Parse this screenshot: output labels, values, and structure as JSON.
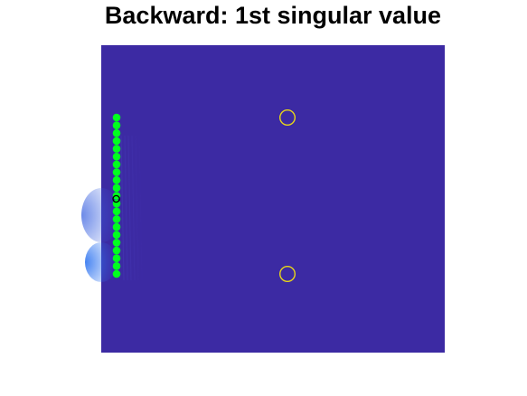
{
  "chart_data": {
    "type": "scatter",
    "title": "Backward: 1st singular value",
    "xlabel": "",
    "ylabel": "",
    "axes_visible": false,
    "background_field": {
      "kind": "intensity-map",
      "base_color": "#3c2aa3",
      "hotspot_color": "#2f74f0",
      "hotspot_location": "left edge, near array"
    },
    "series": [
      {
        "marker": "filled-circle",
        "color": "#00ff1f",
        "points": [
          {
            "x": 1,
            "y": 1
          },
          {
            "x": 1,
            "y": 2
          },
          {
            "x": 1,
            "y": 3
          },
          {
            "x": 1,
            "y": 4
          },
          {
            "x": 1,
            "y": 5
          },
          {
            "x": 1,
            "y": 6
          },
          {
            "x": 1,
            "y": 7
          },
          {
            "x": 1,
            "y": 8
          },
          {
            "x": 1,
            "y": 9
          },
          {
            "x": 1,
            "y": 10
          },
          {
            "x": 1,
            "y": 11
          },
          {
            "x": 1,
            "y": 12
          },
          {
            "x": 1,
            "y": 13
          },
          {
            "x": 1,
            "y": 14
          },
          {
            "x": 1,
            "y": 15
          },
          {
            "x": 1,
            "y": 16
          },
          {
            "x": 1,
            "y": 17
          },
          {
            "x": 1,
            "y": 18
          },
          {
            "x": 1,
            "y": 19
          },
          {
            "x": 1,
            "y": 20
          },
          {
            "x": 1,
            "y": 21
          }
        ]
      },
      {
        "marker": "open-circle",
        "color": "#e8d619",
        "points": [
          {
            "x": 24,
            "y": 1
          },
          {
            "x": 24,
            "y": 21
          }
        ]
      },
      {
        "marker": "small-open-circle",
        "color": "#000000",
        "points": [
          {
            "x": 0.95,
            "y": 11.4
          }
        ]
      }
    ]
  }
}
